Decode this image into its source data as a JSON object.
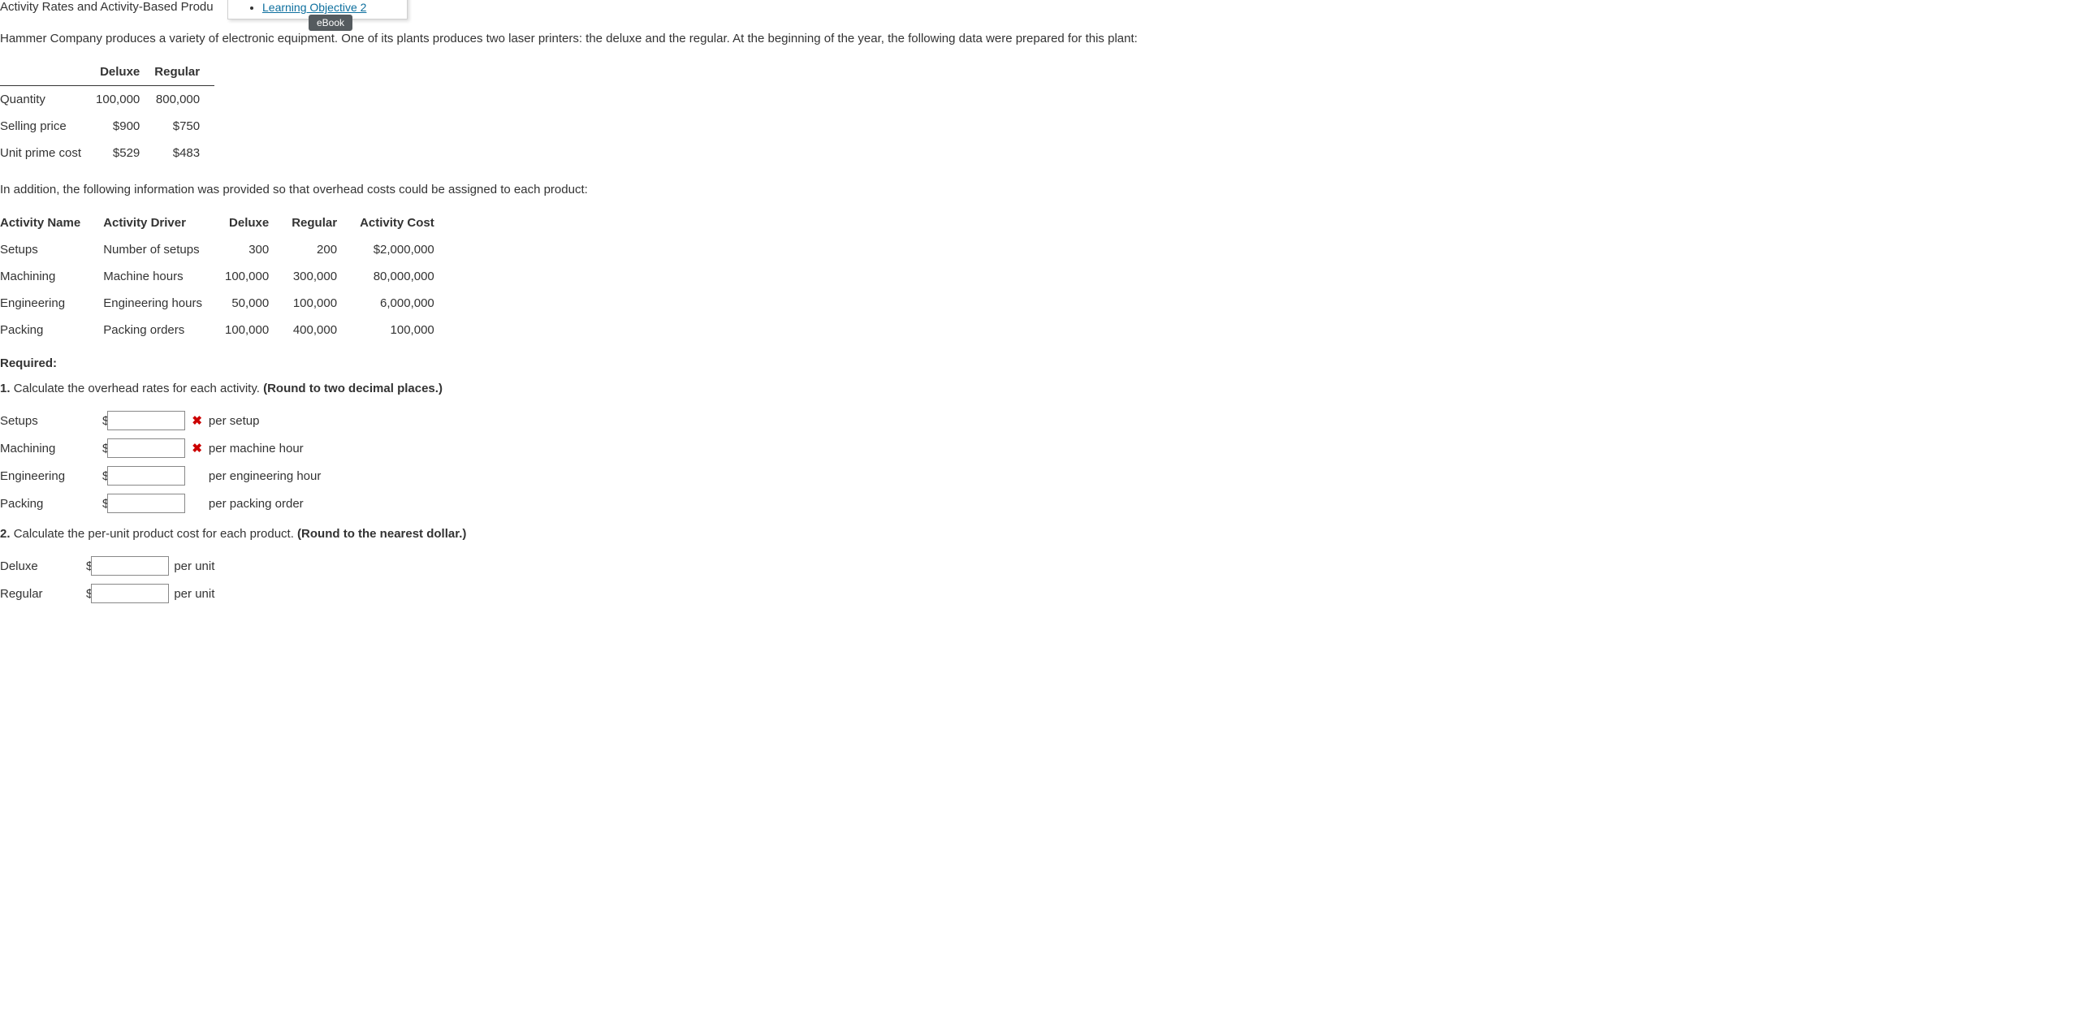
{
  "top": {
    "title_fragment": "Activity Rates and Activity-Based Produ",
    "link_text": "Learning Objective 2",
    "tooltip": "eBook"
  },
  "intro": "Hammer Company produces a variety of electronic equipment. One of its plants produces two laser printers: the deluxe and the regular. At the beginning of the year, the following data were prepared for this plant:",
  "table1": {
    "headers": [
      "",
      "Deluxe",
      "Regular"
    ],
    "rows": [
      {
        "label": "Quantity",
        "deluxe": "100,000",
        "regular": "800,000"
      },
      {
        "label": "Selling price",
        "deluxe": "$900",
        "regular": "$750"
      },
      {
        "label": "Unit prime cost",
        "deluxe": "$529",
        "regular": "$483"
      }
    ]
  },
  "para2": "In addition, the following information was provided so that overhead costs could be assigned to each product:",
  "table2": {
    "headers": [
      "Activity Name",
      "Activity Driver",
      "Deluxe",
      "Regular",
      "Activity Cost"
    ],
    "rows": [
      {
        "name": "Setups",
        "driver": "Number of setups",
        "deluxe": "300",
        "regular": "200",
        "cost": "$2,000,000"
      },
      {
        "name": "Machining",
        "driver": "Machine hours",
        "deluxe": "100,000",
        "regular": "300,000",
        "cost": "80,000,000"
      },
      {
        "name": "Engineering",
        "driver": "Engineering hours",
        "deluxe": "50,000",
        "regular": "100,000",
        "cost": "6,000,000"
      },
      {
        "name": "Packing",
        "driver": "Packing orders",
        "deluxe": "100,000",
        "regular": "400,000",
        "cost": "100,000"
      }
    ]
  },
  "required_label": "Required:",
  "q1": {
    "num": "1.",
    "text": "Calculate the overhead rates for each activity. ",
    "hint": "(Round to two decimal places.)",
    "rows": [
      {
        "label": "Setups",
        "value": "",
        "wrong": true,
        "suffix": "per setup"
      },
      {
        "label": "Machining",
        "value": "",
        "wrong": true,
        "suffix": "per machine hour"
      },
      {
        "label": "Engineering",
        "value": "",
        "wrong": false,
        "suffix": "per engineering hour"
      },
      {
        "label": "Packing",
        "value": "",
        "wrong": false,
        "suffix": "per packing order"
      }
    ]
  },
  "q2": {
    "num": "2.",
    "text": "Calculate the per-unit product cost for each product. ",
    "hint": "(Round to the nearest dollar.)",
    "rows": [
      {
        "label": "Deluxe",
        "value": "",
        "suffix": "per unit"
      },
      {
        "label": "Regular",
        "value": "",
        "suffix": "per unit"
      }
    ]
  },
  "symbols": {
    "dollar": "$",
    "x": "✖"
  }
}
